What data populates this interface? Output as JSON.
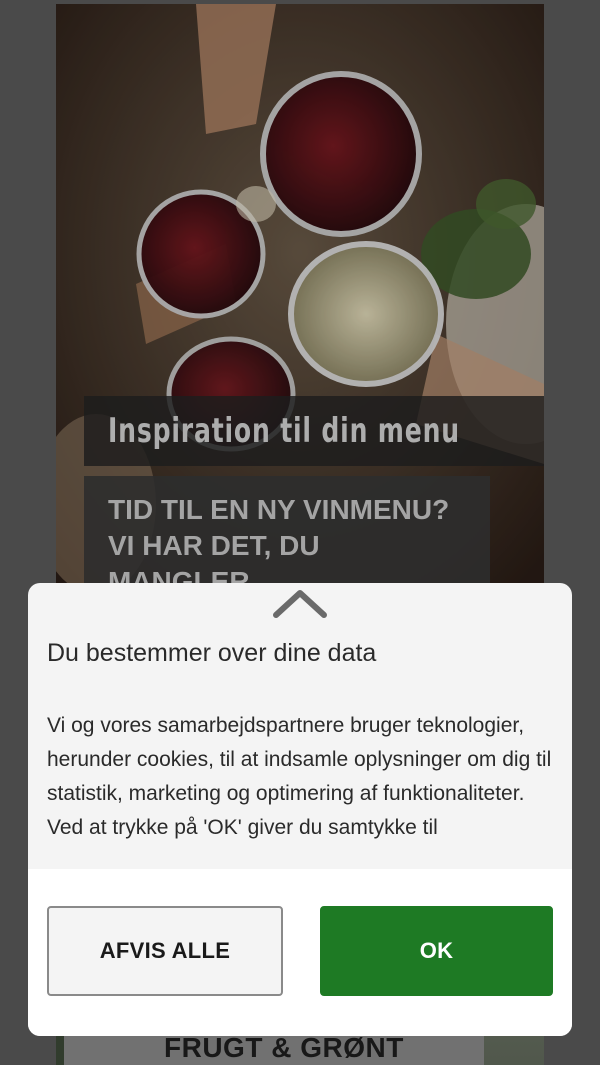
{
  "hero": {
    "tag": "Inspiration til din menu",
    "headline_lines": [
      "TID TIL EN NY VINMENU?",
      "VI HAR DET, DU",
      "MANGLER"
    ],
    "image_icon": "wine-glasses-photo"
  },
  "bottom_section": {
    "label": "FRUGT & GRØNT"
  },
  "consent": {
    "collapse_icon": "chevron-up-icon",
    "title": "Du bestemmer over dine data",
    "body_lines": [
      "Vi og vores samarbejdspartnere bruger teknologier, herunder cookies, til at indsamle oplysninger om dig til statistik, marketing og optimering af funktionaliteter.",
      "Ved at trykke på 'OK' giver du samtykke til"
    ],
    "reject_label": "AFVIS ALLE",
    "ok_label": "OK",
    "colors": {
      "ok_button": "#1e7a24",
      "modal_background": "#f4f4f4"
    }
  }
}
